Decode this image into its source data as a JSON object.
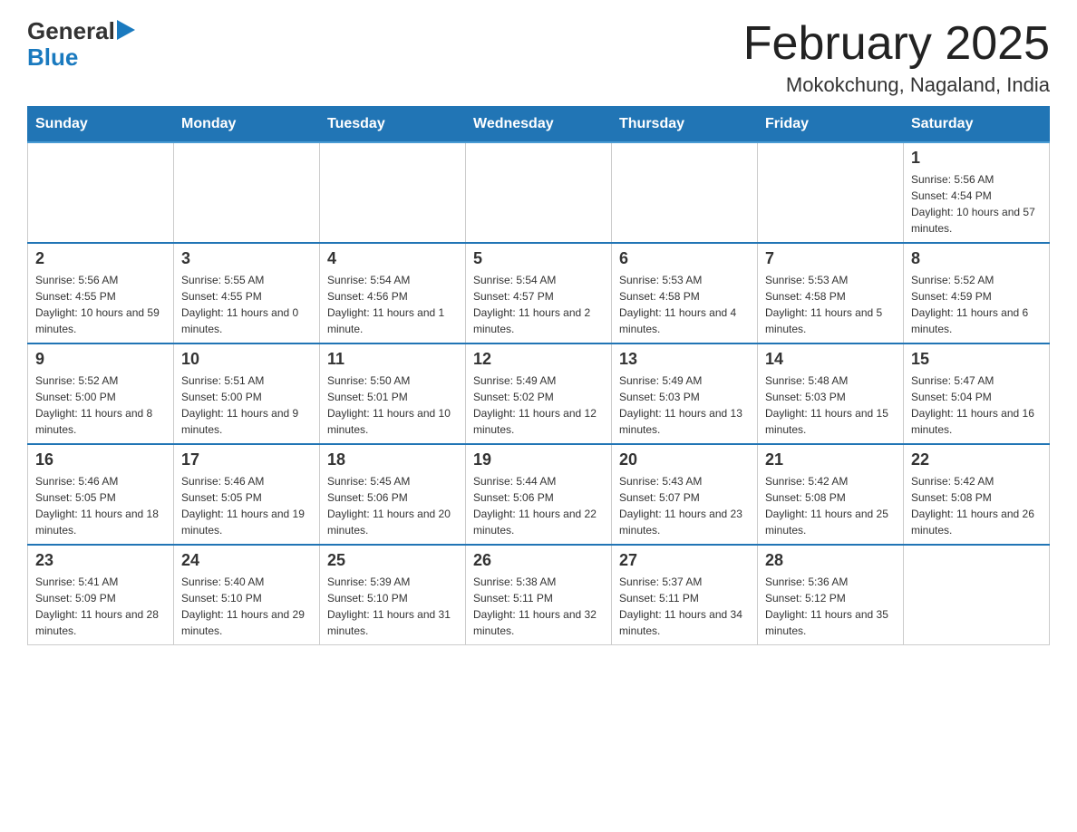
{
  "header": {
    "logo_general": "General",
    "logo_blue": "Blue",
    "title": "February 2025",
    "location": "Mokokchung, Nagaland, India"
  },
  "days_of_week": [
    "Sunday",
    "Monday",
    "Tuesday",
    "Wednesday",
    "Thursday",
    "Friday",
    "Saturday"
  ],
  "weeks": [
    [
      {
        "day": "",
        "sunrise": "",
        "sunset": "",
        "daylight": ""
      },
      {
        "day": "",
        "sunrise": "",
        "sunset": "",
        "daylight": ""
      },
      {
        "day": "",
        "sunrise": "",
        "sunset": "",
        "daylight": ""
      },
      {
        "day": "",
        "sunrise": "",
        "sunset": "",
        "daylight": ""
      },
      {
        "day": "",
        "sunrise": "",
        "sunset": "",
        "daylight": ""
      },
      {
        "day": "",
        "sunrise": "",
        "sunset": "",
        "daylight": ""
      },
      {
        "day": "1",
        "sunrise": "Sunrise: 5:56 AM",
        "sunset": "Sunset: 4:54 PM",
        "daylight": "Daylight: 10 hours and 57 minutes."
      }
    ],
    [
      {
        "day": "2",
        "sunrise": "Sunrise: 5:56 AM",
        "sunset": "Sunset: 4:55 PM",
        "daylight": "Daylight: 10 hours and 59 minutes."
      },
      {
        "day": "3",
        "sunrise": "Sunrise: 5:55 AM",
        "sunset": "Sunset: 4:55 PM",
        "daylight": "Daylight: 11 hours and 0 minutes."
      },
      {
        "day": "4",
        "sunrise": "Sunrise: 5:54 AM",
        "sunset": "Sunset: 4:56 PM",
        "daylight": "Daylight: 11 hours and 1 minute."
      },
      {
        "day": "5",
        "sunrise": "Sunrise: 5:54 AM",
        "sunset": "Sunset: 4:57 PM",
        "daylight": "Daylight: 11 hours and 2 minutes."
      },
      {
        "day": "6",
        "sunrise": "Sunrise: 5:53 AM",
        "sunset": "Sunset: 4:58 PM",
        "daylight": "Daylight: 11 hours and 4 minutes."
      },
      {
        "day": "7",
        "sunrise": "Sunrise: 5:53 AM",
        "sunset": "Sunset: 4:58 PM",
        "daylight": "Daylight: 11 hours and 5 minutes."
      },
      {
        "day": "8",
        "sunrise": "Sunrise: 5:52 AM",
        "sunset": "Sunset: 4:59 PM",
        "daylight": "Daylight: 11 hours and 6 minutes."
      }
    ],
    [
      {
        "day": "9",
        "sunrise": "Sunrise: 5:52 AM",
        "sunset": "Sunset: 5:00 PM",
        "daylight": "Daylight: 11 hours and 8 minutes."
      },
      {
        "day": "10",
        "sunrise": "Sunrise: 5:51 AM",
        "sunset": "Sunset: 5:00 PM",
        "daylight": "Daylight: 11 hours and 9 minutes."
      },
      {
        "day": "11",
        "sunrise": "Sunrise: 5:50 AM",
        "sunset": "Sunset: 5:01 PM",
        "daylight": "Daylight: 11 hours and 10 minutes."
      },
      {
        "day": "12",
        "sunrise": "Sunrise: 5:49 AM",
        "sunset": "Sunset: 5:02 PM",
        "daylight": "Daylight: 11 hours and 12 minutes."
      },
      {
        "day": "13",
        "sunrise": "Sunrise: 5:49 AM",
        "sunset": "Sunset: 5:03 PM",
        "daylight": "Daylight: 11 hours and 13 minutes."
      },
      {
        "day": "14",
        "sunrise": "Sunrise: 5:48 AM",
        "sunset": "Sunset: 5:03 PM",
        "daylight": "Daylight: 11 hours and 15 minutes."
      },
      {
        "day": "15",
        "sunrise": "Sunrise: 5:47 AM",
        "sunset": "Sunset: 5:04 PM",
        "daylight": "Daylight: 11 hours and 16 minutes."
      }
    ],
    [
      {
        "day": "16",
        "sunrise": "Sunrise: 5:46 AM",
        "sunset": "Sunset: 5:05 PM",
        "daylight": "Daylight: 11 hours and 18 minutes."
      },
      {
        "day": "17",
        "sunrise": "Sunrise: 5:46 AM",
        "sunset": "Sunset: 5:05 PM",
        "daylight": "Daylight: 11 hours and 19 minutes."
      },
      {
        "day": "18",
        "sunrise": "Sunrise: 5:45 AM",
        "sunset": "Sunset: 5:06 PM",
        "daylight": "Daylight: 11 hours and 20 minutes."
      },
      {
        "day": "19",
        "sunrise": "Sunrise: 5:44 AM",
        "sunset": "Sunset: 5:06 PM",
        "daylight": "Daylight: 11 hours and 22 minutes."
      },
      {
        "day": "20",
        "sunrise": "Sunrise: 5:43 AM",
        "sunset": "Sunset: 5:07 PM",
        "daylight": "Daylight: 11 hours and 23 minutes."
      },
      {
        "day": "21",
        "sunrise": "Sunrise: 5:42 AM",
        "sunset": "Sunset: 5:08 PM",
        "daylight": "Daylight: 11 hours and 25 minutes."
      },
      {
        "day": "22",
        "sunrise": "Sunrise: 5:42 AM",
        "sunset": "Sunset: 5:08 PM",
        "daylight": "Daylight: 11 hours and 26 minutes."
      }
    ],
    [
      {
        "day": "23",
        "sunrise": "Sunrise: 5:41 AM",
        "sunset": "Sunset: 5:09 PM",
        "daylight": "Daylight: 11 hours and 28 minutes."
      },
      {
        "day": "24",
        "sunrise": "Sunrise: 5:40 AM",
        "sunset": "Sunset: 5:10 PM",
        "daylight": "Daylight: 11 hours and 29 minutes."
      },
      {
        "day": "25",
        "sunrise": "Sunrise: 5:39 AM",
        "sunset": "Sunset: 5:10 PM",
        "daylight": "Daylight: 11 hours and 31 minutes."
      },
      {
        "day": "26",
        "sunrise": "Sunrise: 5:38 AM",
        "sunset": "Sunset: 5:11 PM",
        "daylight": "Daylight: 11 hours and 32 minutes."
      },
      {
        "day": "27",
        "sunrise": "Sunrise: 5:37 AM",
        "sunset": "Sunset: 5:11 PM",
        "daylight": "Daylight: 11 hours and 34 minutes."
      },
      {
        "day": "28",
        "sunrise": "Sunrise: 5:36 AM",
        "sunset": "Sunset: 5:12 PM",
        "daylight": "Daylight: 11 hours and 35 minutes."
      },
      {
        "day": "",
        "sunrise": "",
        "sunset": "",
        "daylight": ""
      }
    ]
  ]
}
